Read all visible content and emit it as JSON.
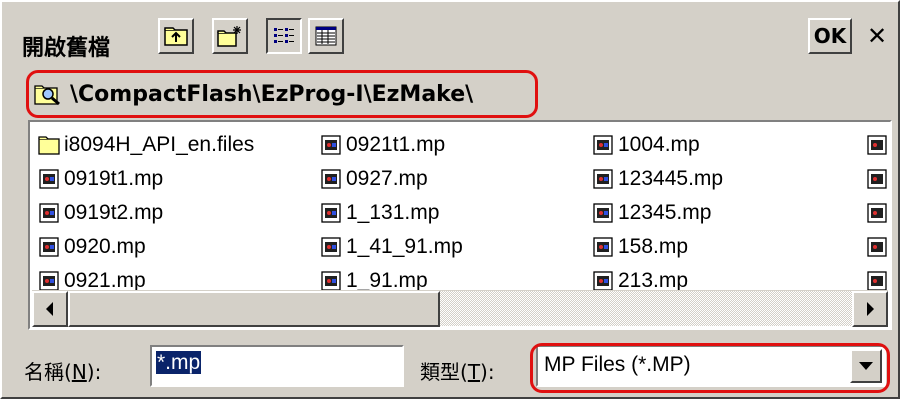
{
  "dialog": {
    "title": "開啟舊檔",
    "ok_label": "OK",
    "close_label": "✕"
  },
  "toolbar": {
    "buttons": [
      {
        "name": "up-folder-icon"
      },
      {
        "name": "new-folder-icon"
      },
      {
        "name": "list-view-icon",
        "pressed": true
      },
      {
        "name": "details-view-icon"
      }
    ]
  },
  "path": {
    "text": "\\CompactFlash\\EzProg-I\\EzMake\\",
    "icon": "folder-search-icon"
  },
  "files": {
    "col1": [
      {
        "name": "i8094H_API_en.files",
        "kind": "folder"
      },
      {
        "name": "0919t1.mp",
        "kind": "file"
      },
      {
        "name": "0919t2.mp",
        "kind": "file"
      },
      {
        "name": "0920.mp",
        "kind": "file"
      },
      {
        "name": "0921.mp",
        "kind": "file"
      }
    ],
    "col2": [
      {
        "name": "0921t1.mp",
        "kind": "file"
      },
      {
        "name": "0927.mp",
        "kind": "file"
      },
      {
        "name": "1_131.mp",
        "kind": "file"
      },
      {
        "name": "1_41_91.mp",
        "kind": "file"
      },
      {
        "name": "1_91.mp",
        "kind": "file"
      }
    ],
    "col3": [
      {
        "name": "1004.mp",
        "kind": "file"
      },
      {
        "name": "123445.mp",
        "kind": "file"
      },
      {
        "name": "12345.mp",
        "kind": "file"
      },
      {
        "name": "158.mp",
        "kind": "file"
      },
      {
        "name": "213.mp",
        "kind": "file"
      }
    ]
  },
  "bottom": {
    "name_label_prefix": "名稱(",
    "name_label_key": "N",
    "name_label_suffix": "):",
    "name_value": "*.mp",
    "type_label_prefix": "類型(",
    "type_label_key": "T",
    "type_label_suffix": "):",
    "type_value": "MP Files (*.MP)"
  },
  "colors": {
    "annotation": "#e01010",
    "selection": "#0a246a",
    "face": "#d4d0c8"
  }
}
